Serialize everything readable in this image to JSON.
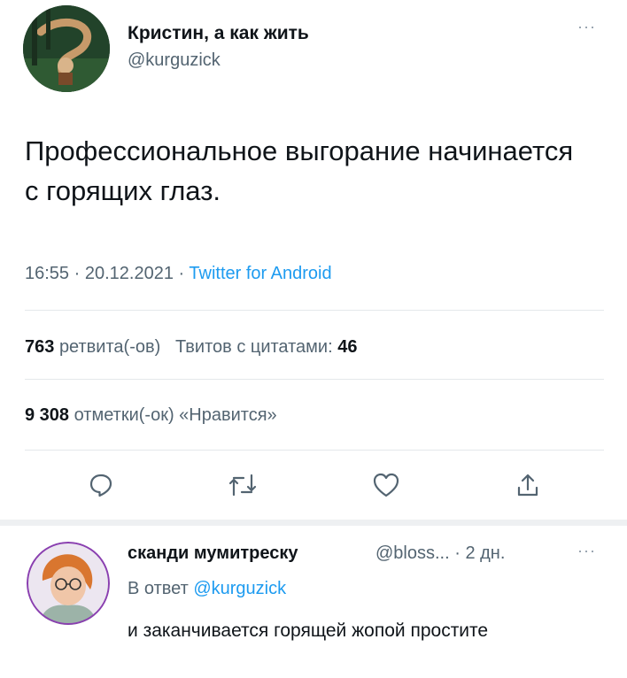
{
  "tweet": {
    "author_name": "Кристин, а как жить",
    "author_handle": "@kurguzick",
    "text": "Профессиональное выгорание начинается с горящих глаз.",
    "time": "16:55",
    "date": "20.12.2021",
    "separator": "·",
    "source": "Twitter for Android",
    "retweets_count": "763",
    "retweets_label": "ретвита(-ов)",
    "quotes_label": "Твитов с цитатами:",
    "quotes_count": "46",
    "likes_count": "9 308",
    "likes_label": "отметки(-ок) «Нравится»",
    "more_glyph": "···"
  },
  "actions": [
    {
      "icon": "reply-icon"
    },
    {
      "icon": "retweet-icon"
    },
    {
      "icon": "like-icon"
    },
    {
      "icon": "share-icon"
    }
  ],
  "reply": {
    "author_name": "сканди мумитреску",
    "author_handle": "@bloss...",
    "time_ago": "· 2 дн.",
    "reply_to_label": "В ответ",
    "reply_to_handle": "@kurguzick",
    "text": "и заканчивается горящей жопой простите",
    "more_glyph": "···"
  },
  "colors": {
    "link": "#1d9bf0",
    "secondary_text": "#536471",
    "primary_text": "#0f1419",
    "divider": "#e4e8eb"
  }
}
